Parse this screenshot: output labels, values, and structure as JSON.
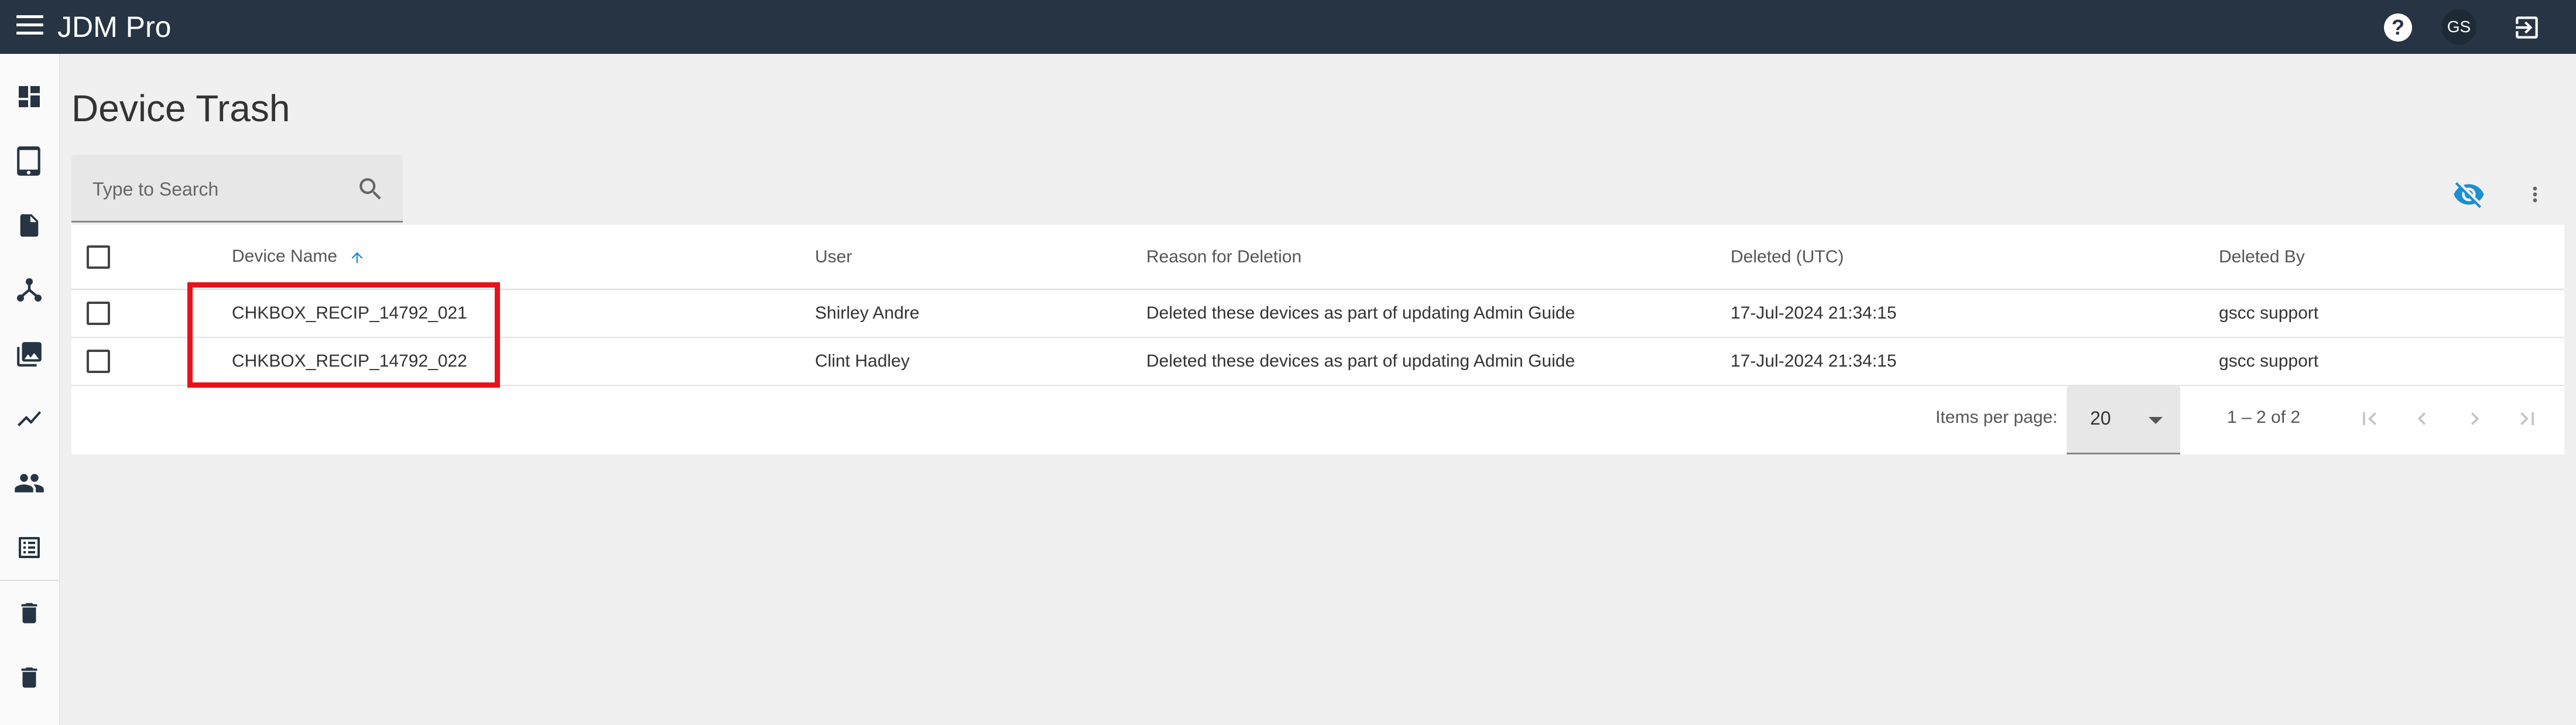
{
  "app": {
    "title": "JDM Pro"
  },
  "topbar": {
    "menu_icon": "menu-icon",
    "help_icon": "help-icon",
    "avatar_initials": "GS",
    "logout_icon": "logout-icon"
  },
  "sidebar": {
    "items": [
      {
        "icon": "dashboard-icon"
      },
      {
        "icon": "tablet-icon"
      },
      {
        "icon": "document-icon"
      },
      {
        "icon": "hierarchy-icon"
      },
      {
        "icon": "gallery-icon"
      },
      {
        "icon": "trend-icon"
      },
      {
        "icon": "users-icon"
      },
      {
        "icon": "list-icon"
      },
      {
        "icon": "trash-icon"
      },
      {
        "icon": "trash-icon"
      }
    ]
  },
  "page": {
    "title": "Device Trash"
  },
  "search": {
    "placeholder": "Type to Search",
    "value": ""
  },
  "toolbar": {
    "visibility_icon": "visibility-off-icon",
    "more_icon": "more-vert-icon"
  },
  "table": {
    "columns": {
      "device_name": "Device Name",
      "user": "User",
      "reason": "Reason for Deletion",
      "deleted": "Deleted (UTC)",
      "deleted_by": "Deleted By"
    },
    "sort_icon": "arrow-up-icon",
    "rows": [
      {
        "device_name": "CHKBOX_RECIP_14792_021",
        "user": "Shirley Andre",
        "reason": "Deleted these devices as part of updating Admin Guide",
        "deleted": "17-Jul-2024 21:34:15",
        "deleted_by": "gscc support"
      },
      {
        "device_name": "CHKBOX_RECIP_14792_022",
        "user": "Clint Hadley",
        "reason": "Deleted these devices as part of updating Admin Guide",
        "deleted": "17-Jul-2024 21:34:15",
        "deleted_by": "gscc support"
      }
    ]
  },
  "paginator": {
    "items_per_page_label": "Items per page:",
    "items_per_page": "20",
    "range_label": "1 – 2 of 2"
  },
  "colors": {
    "topbar": "#263443",
    "accent": "#1a8fd1",
    "highlight": "#e8121b"
  }
}
